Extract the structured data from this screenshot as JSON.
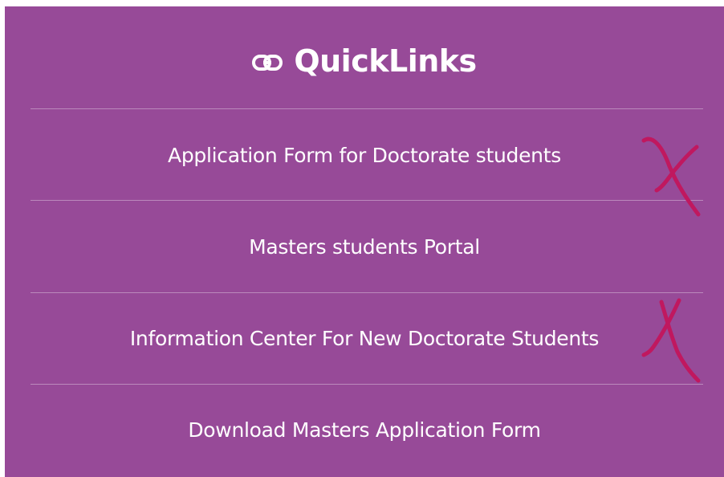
{
  "quicklinks": {
    "title": "QuickLinks",
    "title_icon": "link-icon",
    "links": [
      {
        "label": "Application Form for Doctorate students",
        "crossed_out": true
      },
      {
        "label": "Masters students Portal",
        "crossed_out": false
      },
      {
        "label": "Information Center For New Doctorate Students",
        "crossed_out": true
      },
      {
        "label": "Download Masters Application Form",
        "crossed_out": false
      }
    ]
  },
  "colors": {
    "panel_background": "#974a98",
    "text": "#ffffff",
    "divider": "rgba(255,255,255,0.35)",
    "annotation_mark": "#c0185f"
  }
}
